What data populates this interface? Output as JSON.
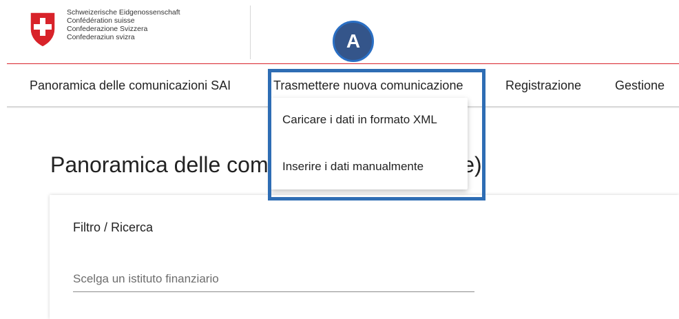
{
  "header": {
    "gov_lines": [
      "Schweizerische Eidgenossenschaft",
      "Confédération suisse",
      "Confederazione Svizzera",
      "Confederaziun svizra"
    ]
  },
  "nav": {
    "items": [
      {
        "label": "Panoramica delle comunicazioni SAI"
      },
      {
        "label": "Trasmettere nuova comunicazione"
      },
      {
        "label": "Registrazione"
      },
      {
        "label": "Gestione"
      }
    ]
  },
  "dropdown": {
    "items": [
      {
        "label": "Caricare i dati in formato XML"
      },
      {
        "label": "Inserire i dati manualmente"
      }
    ]
  },
  "annotation": {
    "badge": "A",
    "color": "#2e6db4"
  },
  "page": {
    "title": "Panoramica delle comunicazioni SAI (panoramica: questione)",
    "title_visible_left": "Panoramica delle com",
    "title_visible_right": "one)"
  },
  "filter": {
    "title": "Filtro / Ricerca",
    "select_placeholder": "Scelga un istituto finanziario"
  },
  "colors": {
    "swiss_red": "#d8232a",
    "accent_blue": "#2e6db4"
  }
}
